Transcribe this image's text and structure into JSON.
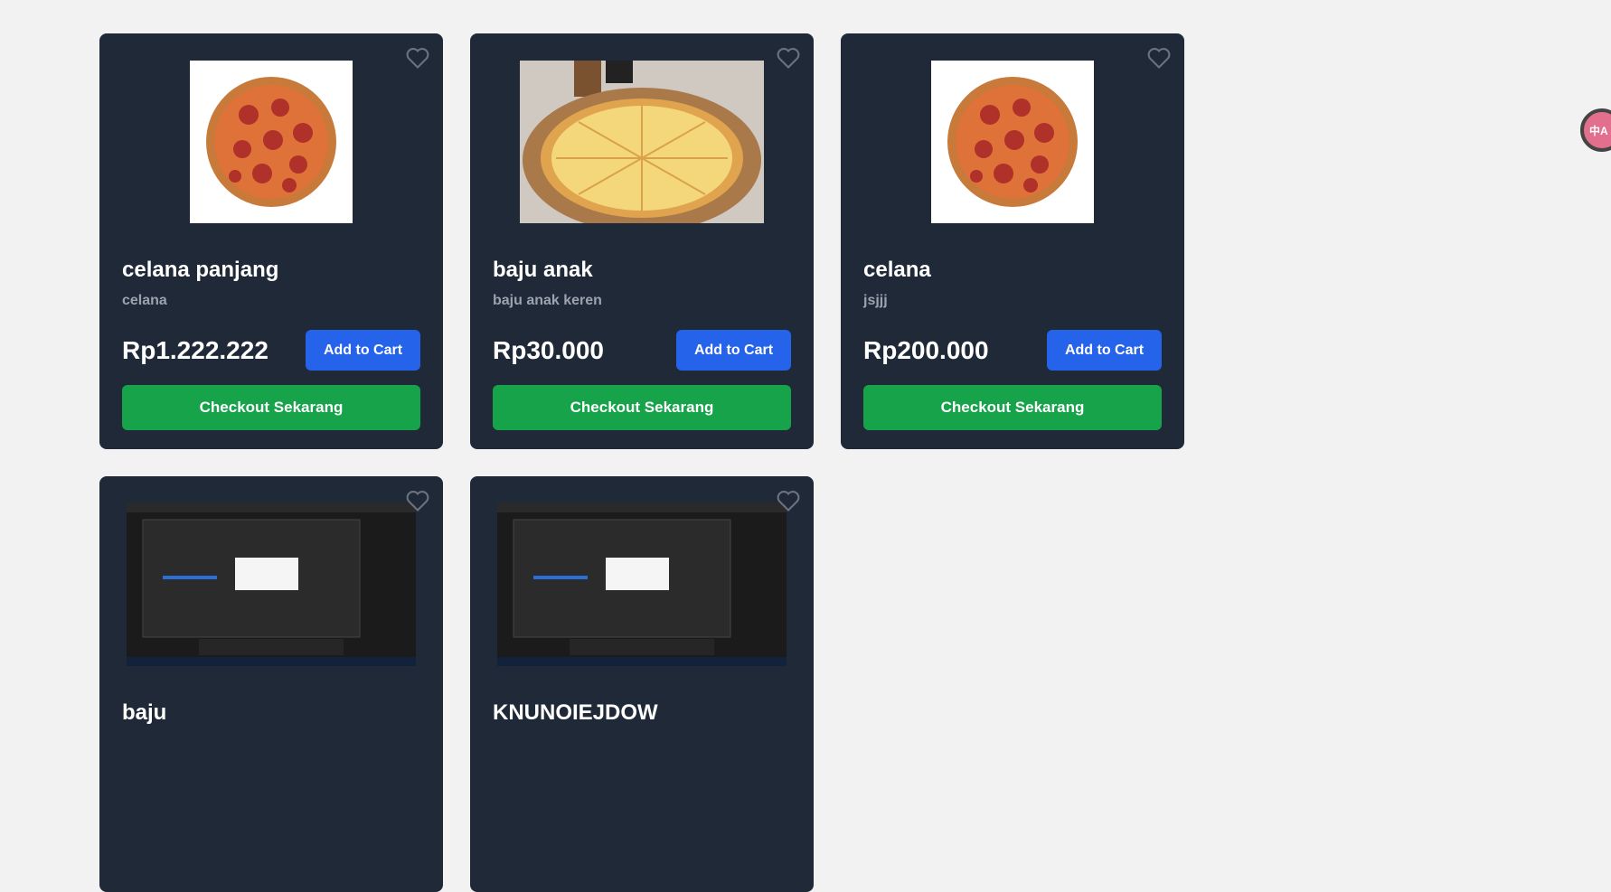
{
  "products": [
    {
      "title": "celana panjang",
      "subtitle": "celana",
      "price": "Rp1.222.222",
      "cart_label": "Add to Cart",
      "checkout_label": "Checkout Sekarang",
      "image": "pepperoni-pizza"
    },
    {
      "title": "baju anak",
      "subtitle": "baju anak keren",
      "price": "Rp30.000",
      "cart_label": "Add to Cart",
      "checkout_label": "Checkout Sekarang",
      "image": "cheese-pizza"
    },
    {
      "title": "celana",
      "subtitle": "jsjjj",
      "price": "Rp200.000",
      "cart_label": "Add to Cart",
      "checkout_label": "Checkout Sekarang",
      "image": "pepperoni-pizza"
    },
    {
      "title": "baju",
      "image": "screenshot"
    },
    {
      "title": "KNUNOIEJDOW",
      "image": "screenshot"
    }
  ],
  "icons": {
    "favorite": "heart-outline-icon",
    "translate": "translate-icon"
  },
  "colors": {
    "card_bg": "#1f2937",
    "page_bg": "#f2f2f2",
    "cart_button": "#2563eb",
    "checkout_button": "#16a34a",
    "subtitle": "#9ca3af"
  },
  "side_widget": {
    "label": "中A"
  }
}
